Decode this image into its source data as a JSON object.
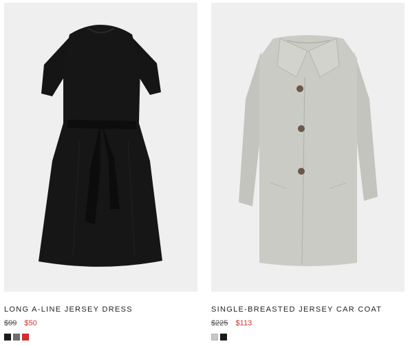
{
  "products": [
    {
      "title": "LONG A-LINE JERSEY DRESS",
      "old_price": "$99",
      "sale_price": "$50",
      "image_icon": "black-dress-image",
      "swatches": [
        "#1c1c1c",
        "#6f6f6f",
        "#d3302b"
      ]
    },
    {
      "title": "SINGLE-BREASTED JERSEY CAR COAT",
      "old_price": "$225",
      "sale_price": "$113",
      "image_icon": "grey-coat-image",
      "swatches": [
        "#c8c8c2",
        "#1a1a1a"
      ]
    }
  ],
  "colors": {
    "background": "#ffffff",
    "image_background": "#efefef",
    "sale_price": "#d0342c",
    "text": "#222222"
  }
}
